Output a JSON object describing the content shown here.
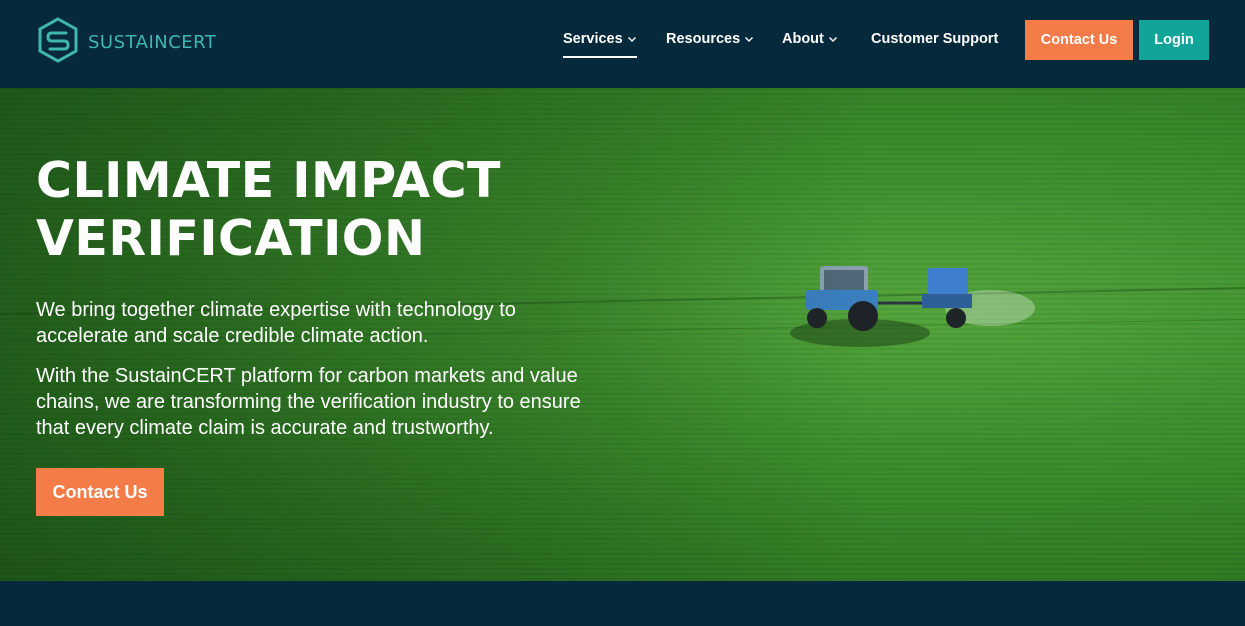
{
  "brand": {
    "name": "SUSTAINCERT",
    "logo_icon": "hexagon-s-logo-icon"
  },
  "nav": {
    "items": [
      {
        "label": "Services",
        "has_dropdown": true,
        "active": true
      },
      {
        "label": "Resources",
        "has_dropdown": true,
        "active": false
      },
      {
        "label": "About",
        "has_dropdown": true,
        "active": false
      },
      {
        "label": "Customer Support",
        "has_dropdown": false,
        "active": false
      }
    ],
    "contact_label": "Contact Us",
    "login_label": "Login"
  },
  "hero": {
    "title": "CLIMATE IMPACT\nVERIFICATION",
    "paragraph_1": "We bring together climate expertise with technology to accelerate and scale credible climate action.",
    "paragraph_2": "With the SustainCERT platform for carbon markets and value chains, we are transforming the verification industry to ensure that every climate claim is accurate and trustworthy.",
    "cta_label": "Contact Us",
    "image": "aerial-green-field-tractor-spraying"
  },
  "colors": {
    "navy": "#06293b",
    "orange": "#f47c48",
    "teal": "#11a59a",
    "brand_teal": "#3fb7b0",
    "field_green": "#3d8e2c"
  }
}
